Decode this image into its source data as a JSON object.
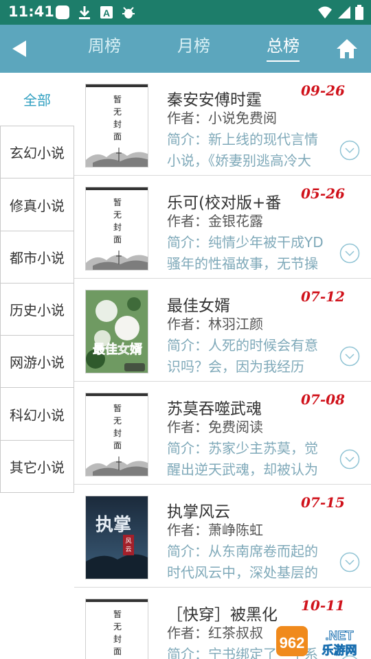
{
  "status_bar": {
    "time": "11:41",
    "icons": [
      "app-square-icon",
      "download-icon",
      "text-a-icon",
      "bug-icon",
      "wifi-icon",
      "signal-icon",
      "battery-icon"
    ]
  },
  "header": {
    "tabs": [
      {
        "label": "周榜",
        "active": false
      },
      {
        "label": "月榜",
        "active": false
      },
      {
        "label": "总榜",
        "active": true
      }
    ]
  },
  "sidebar": {
    "items": [
      {
        "label": "全部",
        "active": true
      },
      {
        "label": "玄幻小说",
        "active": false
      },
      {
        "label": "修真小说",
        "active": false
      },
      {
        "label": "都市小说",
        "active": false
      },
      {
        "label": "历史小说",
        "active": false
      },
      {
        "label": "网游小说",
        "active": false
      },
      {
        "label": "科幻小说",
        "active": false
      },
      {
        "label": "其它小说",
        "active": false
      }
    ]
  },
  "placeholder_cover": {
    "line1": "暂",
    "line2": "无",
    "line3": "封",
    "line4": "面"
  },
  "books": [
    {
      "title": "秦安安傅时霆",
      "date": "09-26",
      "author": "作者：小说免费阅",
      "intro": "简介：新上线的现代言情小说，《娇妻别逃高冷大",
      "cover": "placeholder"
    },
    {
      "title": "乐可(校对版+番",
      "date": "05-26",
      "author": "作者：金银花露",
      "intro": "简介：纯情少年被干成YD骚年的性福故事，无节操",
      "cover": "placeholder"
    },
    {
      "title": "最佳女婿",
      "date": "07-12",
      "author": "作者：林羽江颜",
      "intro": "简介：人死的时候会有意识吗？会，因为我经历",
      "cover": "flower",
      "cover_text": "最佳女婿"
    },
    {
      "title": "苏莫吞噬武魂",
      "date": "07-08",
      "author": "作者：免费阅读",
      "intro": "简介：苏家少主苏莫，觉醒出逆天武魂，却被认为",
      "cover": "placeholder"
    },
    {
      "title": "执掌风云",
      "date": "07-15",
      "author": "作者：萧峥陈虹",
      "intro": "简介：从东南席卷而起的时代风云中，深处基层的",
      "cover": "storm",
      "cover_text": "执掌",
      "cover_sub": "风云"
    },
    {
      "title": "［快穿］被黑化",
      "date": "10-11",
      "author": "作者：红茶叔叔",
      "intro": "简介：宁书绑定了一个系",
      "cover": "placeholder"
    }
  ],
  "watermark": {
    "text": "962.NET",
    "sub": "乐游网"
  },
  "colors": {
    "status_bar": "#1d7d6a",
    "header": "#5ca6bd",
    "accent": "#2f9fc0",
    "date": "#d0121b",
    "intro": "#7fa9b9"
  }
}
